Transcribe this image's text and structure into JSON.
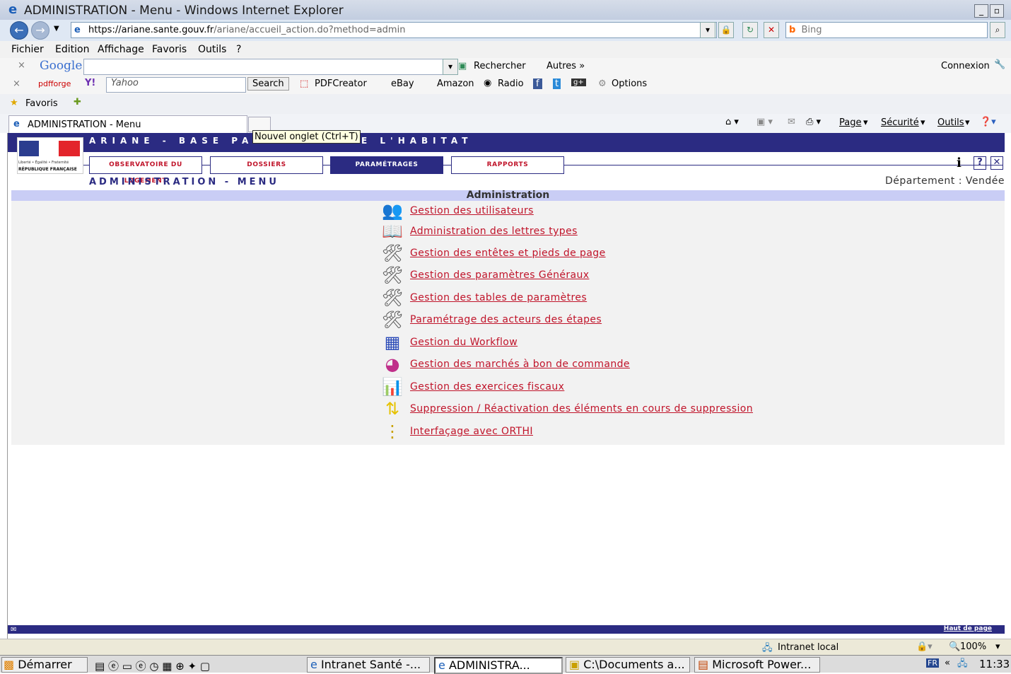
{
  "window": {
    "title": "ADMINISTRATION - Menu - Windows Internet Explorer"
  },
  "address": {
    "url_main": "https://ariane.sante.gouv.fr",
    "url_rest": "/ariane/accueil_action.do?method=admin",
    "search_placeholder": "Bing"
  },
  "menubar": [
    "Fichier",
    "Edition",
    "Affichage",
    "Favoris",
    "Outils",
    "?"
  ],
  "google_bar": {
    "brand": "Google",
    "search": "Rechercher",
    "more": "Autres »",
    "login": "Connexion"
  },
  "yahoo_bar": {
    "pdfforge": "pdfforge",
    "yahoo": "Yahoo",
    "search_btn": "Search",
    "pdfcreator": "PDFCreator",
    "ebay": "eBay",
    "amazon": "Amazon",
    "radio": "Radio",
    "options": "Options"
  },
  "favorites": {
    "label": "Favoris"
  },
  "tab": {
    "title": "ADMINISTRATION - Menu",
    "tooltip": "Nouvel onglet (Ctrl+T)"
  },
  "command_bar": {
    "page": "Page",
    "security": "Sécurité",
    "tools": "Outils"
  },
  "app": {
    "banner": "ARIANE - BASE PA",
    "banner_end": "E L'HABITAT",
    "logo_motto": "Liberté • Égalité • Fraternité",
    "logo_country": "RÉPUBLIQUE FRANÇAISE",
    "nav": [
      {
        "label": "OBSERVATOIRE DU LOGEMENT",
        "selected": false
      },
      {
        "label": "DOSSIERS",
        "selected": false
      },
      {
        "label": "PARAMÉTRAGES",
        "selected": true
      },
      {
        "label": "RAPPORTS",
        "selected": false
      }
    ],
    "page_heading": "ADMINISTRATION - MENU",
    "department": "Département :  Vendée",
    "section_title": "Administration",
    "items": [
      {
        "label": "Gestion des utilisateurs",
        "icon": "users-icon"
      },
      {
        "label": "Administration des lettres types",
        "icon": "open-book-icon"
      },
      {
        "label": "Gestion des entêtes et pieds de page",
        "icon": "tools-icon"
      },
      {
        "label": "Gestion des paramètres Généraux",
        "icon": "tools-icon"
      },
      {
        "label": "Gestion des tables de paramètres",
        "icon": "tools-icon"
      },
      {
        "label": "Paramétrage des acteurs des étapes",
        "icon": "tools-icon"
      },
      {
        "label": "Gestion du Workflow",
        "icon": "workflow-icon"
      },
      {
        "label": "Gestion des marchés à bon de commande",
        "icon": "pie-chart-icon"
      },
      {
        "label": "Gestion des exercices fiscaux",
        "icon": "chart-icon"
      },
      {
        "label": "Suppression / Réactivation des éléments en cours de suppression",
        "icon": "warning-sign-icon"
      },
      {
        "label": "Interfaçage avec ORTHI",
        "icon": "cables-icon"
      }
    ],
    "footer_link": "Haut de page"
  },
  "status": {
    "zone": "Intranet local",
    "zoom": "100%"
  },
  "taskbar": {
    "start": "Démarrer",
    "tasks": [
      "Intranet Santé -...",
      "ADMINISTRA...",
      "C:\\Documents a...",
      "Microsoft Power..."
    ],
    "lang": "FR",
    "clock": "11:33"
  }
}
